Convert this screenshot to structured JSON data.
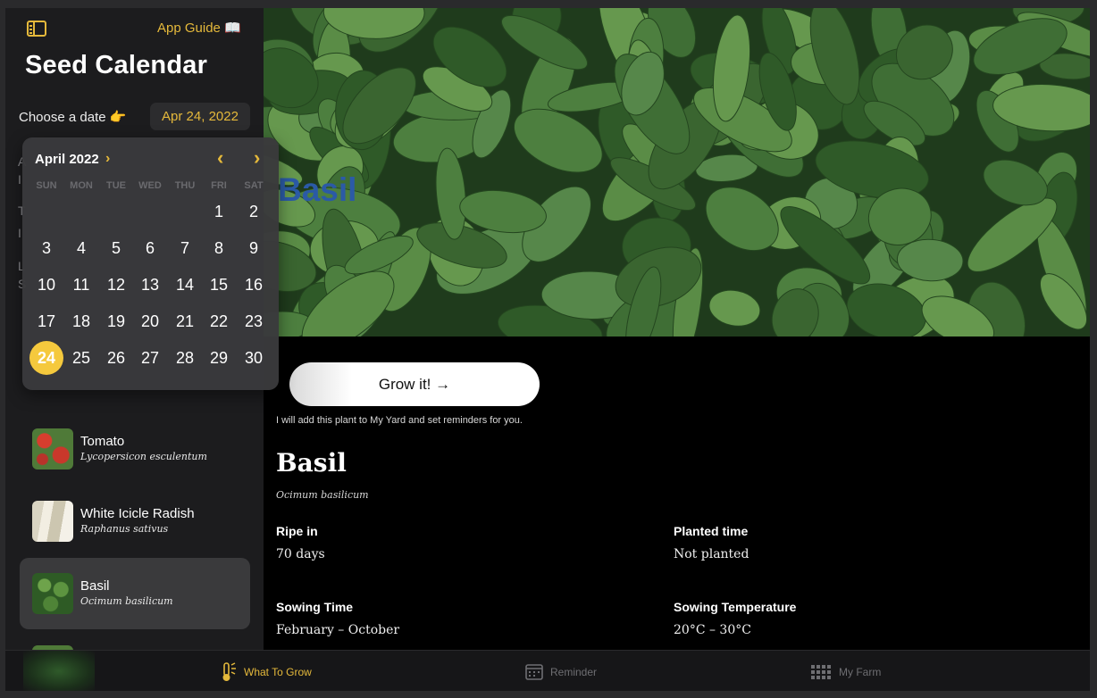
{
  "sidebar": {
    "app_guide": "App Guide 📖",
    "title": "Seed Calendar",
    "choose_label": "Choose a date 👉",
    "selected_date": "Apr 24, 2022",
    "peek_letters": [
      "A",
      "I",
      "T",
      "I",
      "L",
      "S"
    ],
    "plants": [
      {
        "name": "Tomato",
        "latin": "Lycopersicon esculentum",
        "selected": false
      },
      {
        "name": "White Icicle Radish",
        "latin": "Raphanus sativus",
        "selected": false
      },
      {
        "name": "Basil",
        "latin": "Ocimum basilicum",
        "selected": true
      }
    ]
  },
  "calendar": {
    "month_label": "April 2022",
    "weekdays": [
      "SUN",
      "MON",
      "TUE",
      "WED",
      "THU",
      "FRI",
      "SAT"
    ],
    "first_weekday_index": 5,
    "days_in_month": 30,
    "selected_day": 24,
    "icons": {
      "month_chevron": "chevron-right-icon",
      "prev": "chevron-left-icon",
      "next": "chevron-right-icon"
    },
    "accent": "#f5c93d"
  },
  "detail": {
    "hero_title": "Basil",
    "grow_button": "Grow it! →",
    "grow_note": "I will add this plant to My Yard and set reminders for you.",
    "title": "Basil",
    "latin": "Ocimum basilicum",
    "facts": [
      {
        "label": "Ripe in",
        "value": "70 days"
      },
      {
        "label": "Planted time",
        "value": "Not planted"
      },
      {
        "label": "Sowing Time",
        "value": "February – October"
      },
      {
        "label": "Sowing Temperature",
        "value": "20°C – 30°C"
      }
    ]
  },
  "tabs": [
    {
      "label": "What To Grow",
      "icon": "sun-thermometer-icon",
      "active": true
    },
    {
      "label": "Reminder",
      "icon": "calendar-icon",
      "active": false
    },
    {
      "label": "My Farm",
      "icon": "grid-icon",
      "active": false
    }
  ],
  "colors": {
    "accent": "#e5b93b",
    "sidebar_bg": "#1c1c1e",
    "selected_row": "#3a3a3c"
  }
}
